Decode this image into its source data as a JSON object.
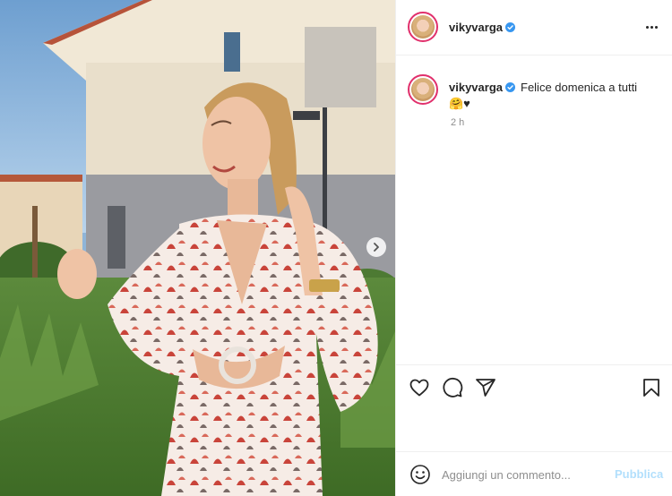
{
  "post": {
    "username": "vikyvarga",
    "verified": true,
    "caption": "Felice domenica a tutti",
    "caption_emojis": "🤗♥",
    "time": "2 h"
  },
  "comment_box": {
    "placeholder": "Aggiungi un commento...",
    "publish_label": "Pubblica"
  },
  "icons": {
    "like": "heart-icon",
    "comment": "comment-icon",
    "share": "share-icon",
    "save": "bookmark-icon",
    "more": "more-options-icon",
    "emoji": "emoji-icon",
    "next": "chevron-right-icon",
    "verified": "verified-badge-icon"
  },
  "colors": {
    "verified_blue": "#3897f0",
    "publish_disabled": "#b2dffc",
    "story_ring": "#e1306c"
  }
}
